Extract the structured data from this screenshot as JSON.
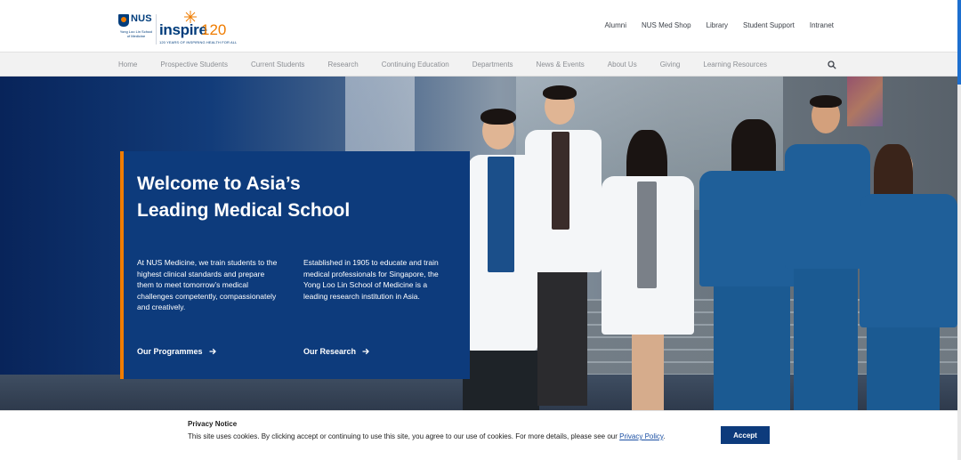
{
  "logos": {
    "nus_text": "NUS",
    "nus_sub": "Yong Loo Lin School of Medicine",
    "inspire_text": "inspire",
    "inspire_number": "120",
    "inspire_tagline": "120 YEARS OF INSPIRING HEALTH FOR ALL"
  },
  "utility_nav": [
    "Alumni",
    "NUS Med Shop",
    "Library",
    "Student Support",
    "Intranet"
  ],
  "main_nav": [
    "Home",
    "Prospective Students",
    "Current Students",
    "Research",
    "Continuing Education",
    "Departments",
    "News & Events",
    "About Us",
    "Giving",
    "Learning Resources"
  ],
  "hero": {
    "title_line1": "Welcome to Asia’s",
    "title_line2": "Leading Medical School",
    "left_text": "At NUS Medicine, we train students to the highest clinical standards and prepare them to meet tomorrow’s medical challenges competently, compassionately and creatively.",
    "right_text": "Established in 1905 to educate and train medical professionals for Singapore, the Yong Loo Lin School of Medicine is a leading research institution in Asia.",
    "cta_left": "Our Programmes",
    "cta_right": "Our Research"
  },
  "privacy": {
    "title": "Privacy Notice",
    "text": "This site uses cookies. By clicking accept or continuing to use this site, you agree to our use of cookies. For more details, please see our ",
    "link": "Privacy Policy",
    "text_end": ".",
    "accept": "Accept"
  },
  "colors": {
    "brand_blue": "#0d3b7c",
    "accent_orange": "#ef7c00"
  }
}
